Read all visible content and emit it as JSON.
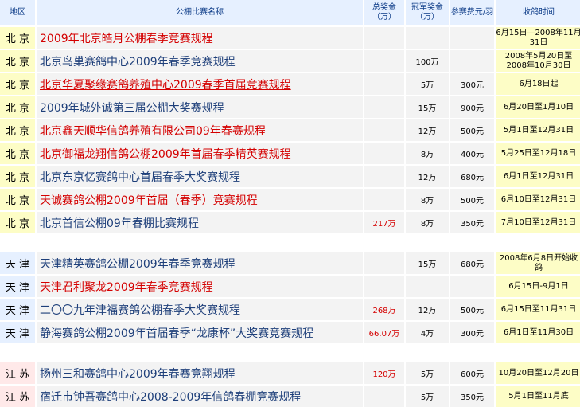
{
  "colors": {
    "header_bg": "#e6f0ff",
    "header_text": "#0b3a87",
    "link_red": "#d40000",
    "link_blue": "#1e3f7a",
    "date_bg": "#fdfdc6",
    "cell_bg": "#f3f3f3",
    "region_bg_beijing": "#fdfdc6",
    "region_bg_tianjin": "#e6f0ff",
    "region_bg_jiangsu": "#ffe9e9"
  },
  "headers": {
    "region": "地区",
    "name": "公棚比赛名称",
    "total_prize": "总奖金（万）",
    "champion_prize": "冠军奖金（万）",
    "entry_fee": "参赛费元/羽",
    "collect_time": "收鸽时间"
  },
  "groups": [
    {
      "region_bg": "#fdfdc6",
      "rows": [
        {
          "region": "北 京",
          "name": "2009年北京皓月公棚春季竞赛规程",
          "color": "red",
          "underline": false,
          "total": "",
          "champion": "",
          "fee": "",
          "time": "6月15日—2008年11月31日"
        },
        {
          "region": "北 京",
          "name": "北京鸟巢赛鸽中心2009年春季竞赛规程",
          "color": "blue",
          "underline": false,
          "total": "",
          "champion": "100万",
          "fee": "",
          "time": "2008年5月20日至2008年10月30日"
        },
        {
          "region": "北 京",
          "name": "北京华夏聚缘赛鸽养殖中心2009春季首届竞赛规程",
          "color": "red",
          "underline": true,
          "total": "",
          "champion": "5万",
          "fee": "300元",
          "time": "6月18日起"
        },
        {
          "region": "北 京",
          "name": "2009年城外诚第三届公棚大奖赛规程",
          "color": "blue",
          "underline": false,
          "total": "",
          "champion": "15万",
          "fee": "900元",
          "time": "6月20日至1月10日"
        },
        {
          "region": "北 京",
          "name": "北京鑫天顺华信鸽养殖有限公司09年春赛规程",
          "color": "red",
          "underline": false,
          "total": "",
          "champion": "12万",
          "fee": "500元",
          "time": "5月1日至12月31日"
        },
        {
          "region": "北 京",
          "name": "北京御福龙翔信鸽公棚2009年首届春季精英赛规程",
          "color": "red",
          "underline": false,
          "total": "",
          "champion": "8万",
          "fee": "400元",
          "time": "5月25日至12月18日"
        },
        {
          "region": "北 京",
          "name": "北京东京亿赛鸽中心首届春季大奖赛规程",
          "color": "blue",
          "underline": false,
          "total": "",
          "champion": "12万",
          "fee": "680元",
          "time": "6月1日至12月31日"
        },
        {
          "region": "北 京",
          "name": "天诚赛鸽公棚2009年首届（春季）竞赛规程",
          "color": "red",
          "underline": false,
          "total": "",
          "champion": "8万",
          "fee": "500元",
          "time": "6月10日至12月31日"
        },
        {
          "region": "北 京",
          "name": "北京首信公棚09年春棚比赛规程",
          "color": "blue",
          "underline": false,
          "total": "217万",
          "champion": "8万",
          "fee": "350元",
          "time": "7月10日至12月31日"
        }
      ]
    },
    {
      "region_bg": "#e6f0ff",
      "rows": [
        {
          "region": "天 津",
          "name": "天津精英赛鸽公棚2009年春季竞赛规程",
          "color": "blue",
          "underline": false,
          "total": "",
          "champion": "15万",
          "fee": "680元",
          "time": "2008年6月8日开始收鸽"
        },
        {
          "region": "天 津",
          "name": "天津君利聚龙2009年春季竞赛规程",
          "color": "red",
          "underline": false,
          "total": "",
          "champion": "",
          "fee": "",
          "time": "6月15日-9月1日"
        },
        {
          "region": "天 津",
          "name": "二〇〇九年津福赛鸽公棚春季大奖赛规程",
          "color": "blue",
          "underline": false,
          "total": "268万",
          "champion": "12万",
          "fee": "500元",
          "time": "6月15日至11月31日"
        },
        {
          "region": "天 津",
          "name": "静海赛鸽公棚2009年首届春季“龙康杯”大奖赛竞赛规程",
          "color": "blue",
          "underline": false,
          "total": "66.07万",
          "champion": "4万",
          "fee": "300元",
          "time": "6月1日至11月30日"
        }
      ]
    },
    {
      "region_bg": "#ffe9e9",
      "rows": [
        {
          "region": "江 苏",
          "name": "扬州三和赛鸽中心2009年春赛竞翔规程",
          "color": "blue",
          "underline": false,
          "total": "120万",
          "champion": "5万",
          "fee": "600元",
          "time": "10月20日至12月20日"
        },
        {
          "region": "江 苏",
          "name": "宿迁市钟吾赛鸽中心2008-2009年信鸽春棚竞赛规程",
          "color": "blue",
          "underline": false,
          "total": "",
          "champion": "5万",
          "fee": "350元",
          "time": "5月1日至11月底"
        }
      ]
    }
  ]
}
